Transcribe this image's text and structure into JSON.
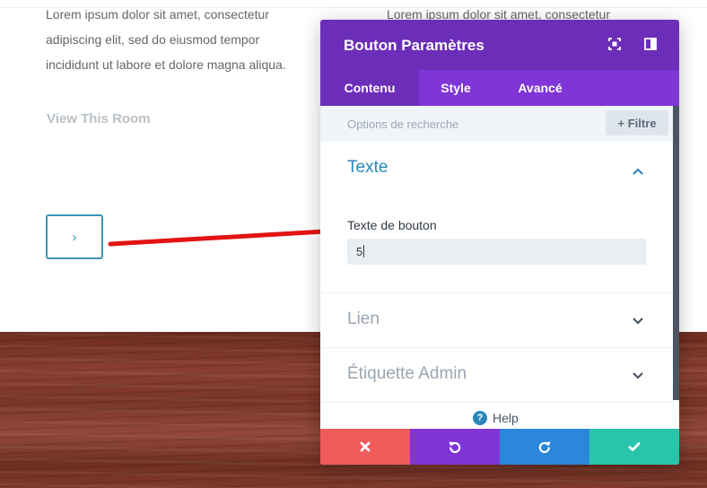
{
  "page": {
    "lorem_left": "Lorem ipsum dolor sit amet, consectetur adipiscing elit, sed do eiusmod tempor incididunt ut labore et dolore magna aliqua.",
    "lorem_right": "Lorem ipsum dolor sit amet, consectetur",
    "view_room": "View This Room",
    "arrow_button_glyph": "›"
  },
  "modal": {
    "title": "Bouton Paramètres",
    "header_icons": [
      "expand-icon",
      "split-view-icon"
    ],
    "tabs": [
      {
        "label": "Contenu",
        "active": true
      },
      {
        "label": "Style",
        "active": false
      },
      {
        "label": "Avancé",
        "active": false
      }
    ],
    "search_placeholder": "Options de recherche",
    "filter_label": "+ Filtre",
    "sections": {
      "texte": {
        "title": "Texte",
        "expanded": true
      },
      "lien": {
        "title": "Lien",
        "expanded": false
      },
      "etiquette": {
        "title": "Étiquette Admin",
        "expanded": false
      }
    },
    "field_label": "Texte de bouton",
    "field_value": "5",
    "help_label": "Help",
    "footer_icons": [
      "close-icon",
      "undo-icon",
      "redo-icon",
      "check-icon"
    ]
  },
  "colors": {
    "header_purple": "#6c2eb9",
    "tabs_purple": "#8035d6",
    "accent_blue": "#2b87b9",
    "cancel_red": "#ef5a5a",
    "redo_blue": "#2b87da",
    "save_teal": "#29c4a9",
    "annotation_red": "#e31414"
  }
}
